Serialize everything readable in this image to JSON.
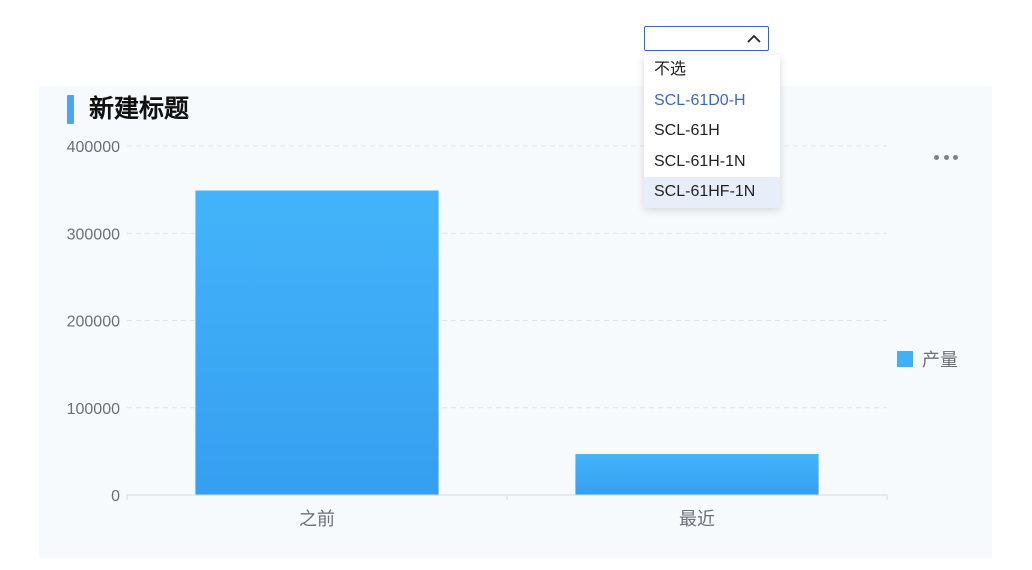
{
  "chart_title": "新建标题",
  "select": {
    "value": "",
    "options": [
      "不选",
      "SCL-61D0-H",
      "SCL-61H",
      "SCL-61H-1N",
      "SCL-61HF-1N"
    ],
    "selected_index": 1,
    "hovered_index": 4
  },
  "legend": {
    "label": "产量",
    "color": "#41b0f7"
  },
  "chart_data": {
    "type": "bar",
    "title": "新建标题",
    "categories": [
      "之前",
      "最近"
    ],
    "series": [
      {
        "name": "产量",
        "values": [
          349000,
          47000
        ]
      }
    ],
    "ylim": [
      0,
      400000
    ],
    "yticks": [
      "400000",
      "300000",
      "200000",
      "100000",
      "0"
    ],
    "xlabel": "",
    "ylabel": "",
    "grid": true,
    "legend_position": "right",
    "bar_color_top": "#43b4fa",
    "bar_color_bottom": "#359ff0"
  }
}
